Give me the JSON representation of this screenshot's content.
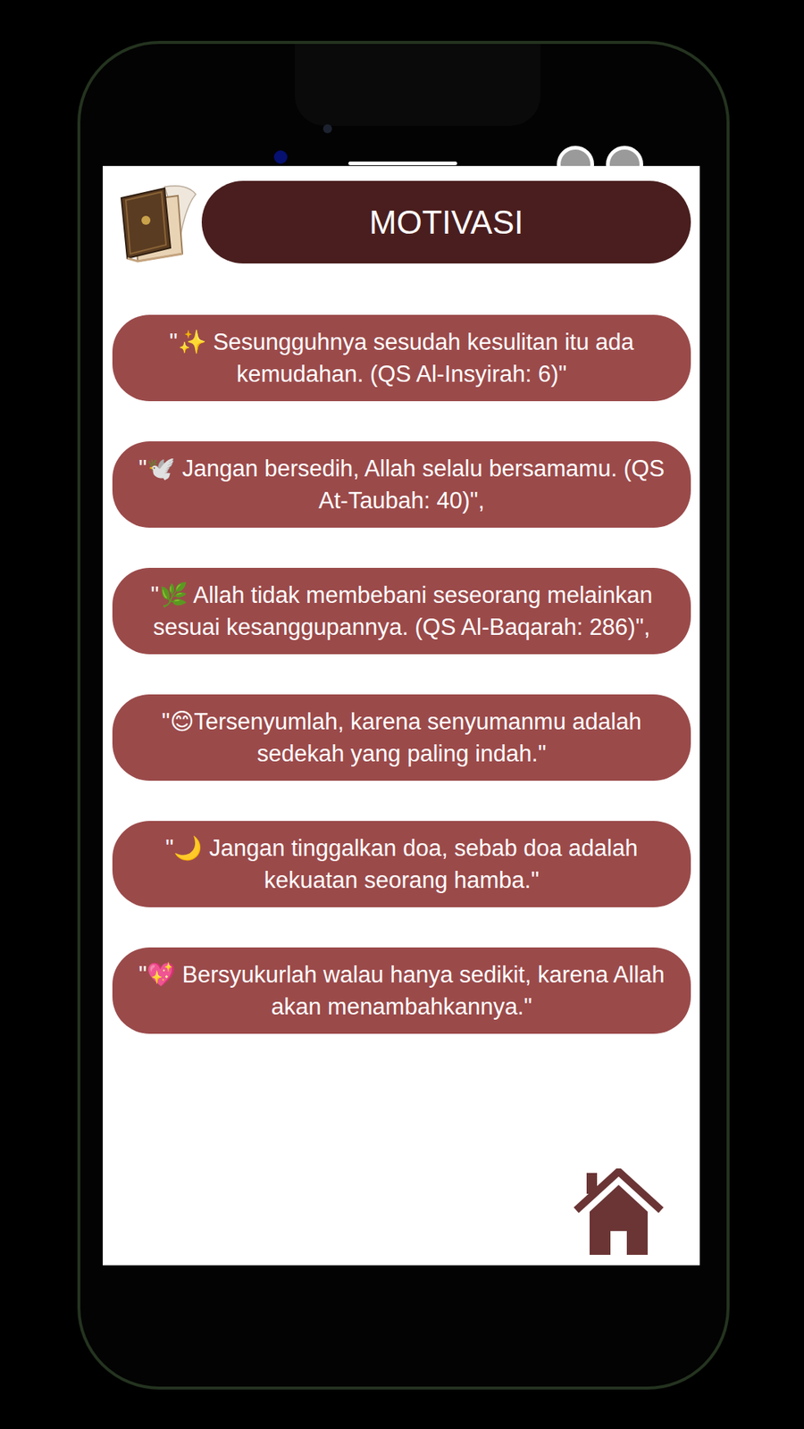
{
  "header": {
    "title": "MOTIVASI"
  },
  "quotes": [
    {
      "text": "\"✨ Sesungguhnya sesudah kesulitan itu ada kemudahan. (QS Al-Insyirah: 6)\""
    },
    {
      "text": "\"🕊️ Jangan bersedih, Allah selalu bersamamu. (QS At-Taubah: 40)\","
    },
    {
      "text": "\"🌿 Allah tidak membebani seseorang melainkan sesuai kesanggupannya. (QS Al-Baqarah: 286)\","
    },
    {
      "text": "\"😊Tersenyumlah, karena senyumanmu adalah sedekah yang paling indah.\""
    },
    {
      "text": "\"🌙 Jangan tinggalkan doa, sebab doa adalah kekuatan seorang hamba.\""
    },
    {
      "text": "\"💖 Bersyukurlah walau hanya sedikit, karena Allah akan menambahkannya.\""
    }
  ]
}
